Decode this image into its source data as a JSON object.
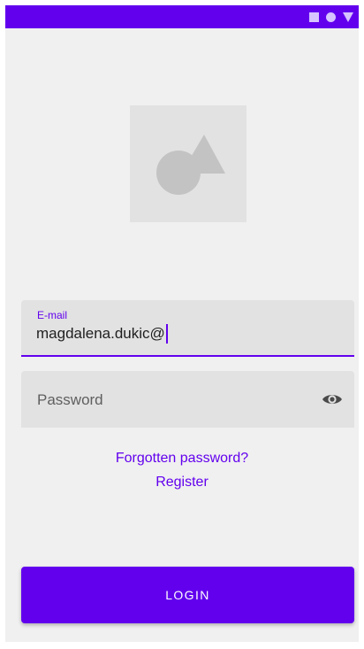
{
  "colors": {
    "accent": "#6200ee",
    "background": "#f0f0f0",
    "field_background": "#e2e2e2"
  },
  "status_bar": {
    "icons": [
      "square-icon",
      "circle-icon",
      "triangle-icon"
    ]
  },
  "logo": {
    "icon": "shapes-placeholder-icon"
  },
  "email_field": {
    "label": "E-mail",
    "value": "magdalena.dukic@"
  },
  "password_field": {
    "placeholder": "Password",
    "toggle_icon": "eye-icon"
  },
  "links": {
    "forgot_password": "Forgotten password?",
    "register": "Register"
  },
  "login_button": {
    "label": "LOGIN"
  }
}
